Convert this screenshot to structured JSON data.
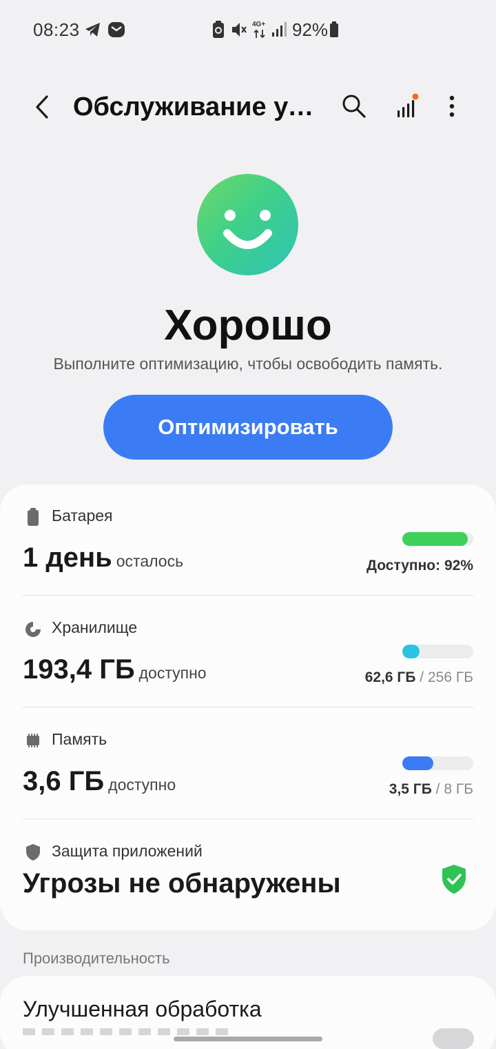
{
  "status_bar": {
    "time": "08:23",
    "network": "4G+",
    "battery_percent": "92%",
    "icons": [
      "telegram-icon",
      "message-icon",
      "battery-saver-icon",
      "mute-icon",
      "network-4g-icon",
      "signal-icon",
      "battery-icon"
    ]
  },
  "app_bar": {
    "title": "Обслуживание ус...",
    "icons": [
      "back-icon",
      "search-icon",
      "stats-icon",
      "more-icon"
    ],
    "notification_dot_color": "#f26b1d"
  },
  "hero": {
    "status_title": "Хорошо",
    "status_subtitle": "Выполните оптимизацию, чтобы освободить память.",
    "optimize_button": "Оптимизировать",
    "accent_color": "#3b7cf5"
  },
  "battery": {
    "label": "Батарея",
    "value": "1 день",
    "value_suffix": "осталось",
    "available_text": "Доступно: 92%",
    "level": 0.92,
    "bar_color": "#3fd157"
  },
  "storage": {
    "label": "Хранилище",
    "value": "193,4 ГБ",
    "value_suffix": "доступно",
    "used": "62,6 ГБ",
    "separator": "/",
    "total": "256 ГБ",
    "level": 0.245,
    "bar_color": "#2bc3e3"
  },
  "memory": {
    "label": "Память",
    "value": "3,6 ГБ",
    "value_suffix": "доступно",
    "used": "3,5 ГБ",
    "separator": "/",
    "total": "8 ГБ",
    "level": 0.44,
    "bar_color": "#3b7cf5"
  },
  "app_protection": {
    "label": "Защита приложений",
    "value": "Угрозы не обнаружены",
    "shield_color": "#2fc257"
  },
  "performance": {
    "section_header": "Производительность",
    "item_title": "Улучшенная обработка"
  }
}
